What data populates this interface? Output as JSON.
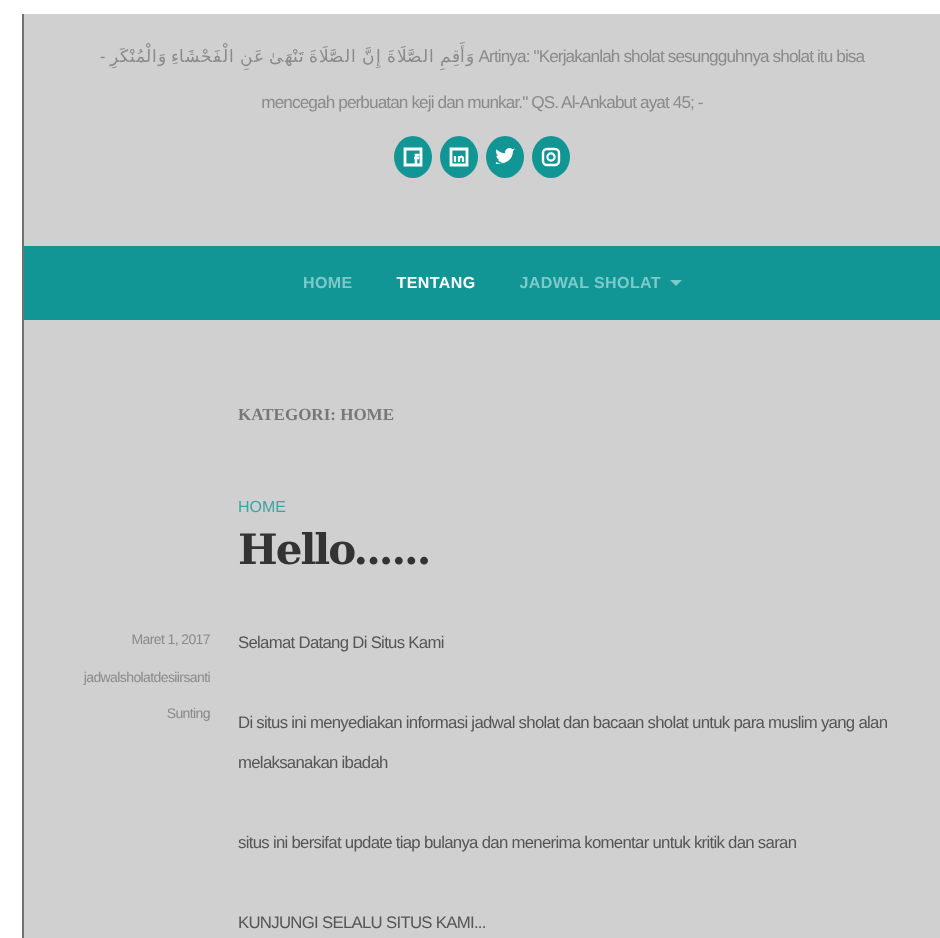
{
  "header": {
    "quote": "- وَأَقِمِ الصَّلَاةَ إِنَّ الصَّلَاةَ تَنْهَىٰ عَنِ الْفَحْشَاءِ وَالْمُنْكَرِ Artinya: \"Kerjakanlah sholat sesungguhnya sholat itu bisa mencegah perbuatan keji dan munkar.\" QS. Al-Ankabut ayat 45; -",
    "social": [
      {
        "kind": "facebook"
      },
      {
        "kind": "linkedin"
      },
      {
        "kind": "twitter"
      },
      {
        "kind": "instagram"
      }
    ]
  },
  "nav": {
    "items": [
      {
        "label": "HOME",
        "selected": false,
        "dropdown": false
      },
      {
        "label": "TENTANG",
        "selected": true,
        "dropdown": false
      },
      {
        "label": "JADWAL SHOLAT",
        "selected": false,
        "dropdown": true
      }
    ]
  },
  "archive_title": "KATEGORI: HOME",
  "post": {
    "category": "HOME",
    "title": "Hello......",
    "date": "Maret 1, 2017",
    "author": "jadwalsholatdesiirsanti",
    "edit": "Sunting",
    "paragraphs": [
      "Selamat Datang Di Situs Kami",
      "Di situs ini menyediakan informasi jadwal sholat dan bacaan sholat untuk para muslim yang alan melaksanakan ibadah",
      "situs ini bersifat update tiap bulanya dan menerima komentar untuk kritik dan saran",
      "KUNJUNGI SELALU SITUS KAMI..."
    ]
  }
}
